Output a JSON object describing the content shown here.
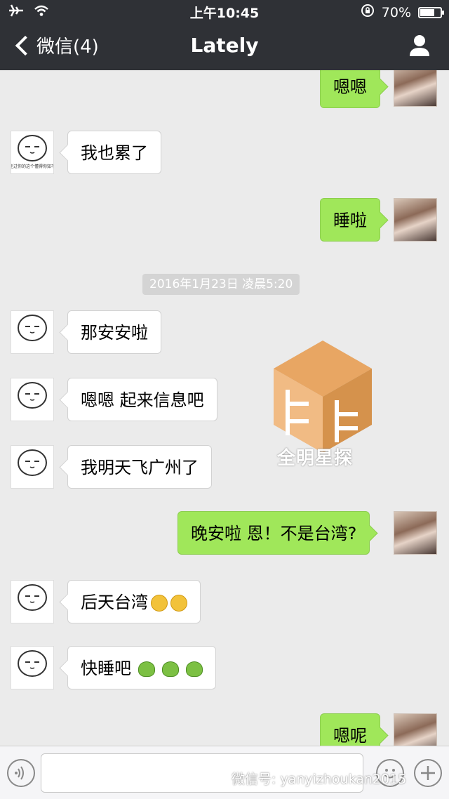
{
  "status_bar": {
    "time": "上午10:45",
    "battery": "70%",
    "battery_level": 0.7
  },
  "nav": {
    "back_label": "微信(4)",
    "title": "Lately"
  },
  "timestamp": "2016年1月23日 凌晨5:20",
  "messages": [
    {
      "side": "right",
      "text": "嗯嗯"
    },
    {
      "side": "left",
      "text": "我也累了"
    },
    {
      "side": "right",
      "text": "睡啦"
    },
    {
      "side": "left",
      "text": "那安安啦"
    },
    {
      "side": "left",
      "text": "嗯嗯 起来信息吧"
    },
    {
      "side": "left",
      "text": "我明天飞广州了"
    },
    {
      "side": "right",
      "text": "晚安啦 恩！不是台湾?"
    },
    {
      "side": "left",
      "text": "后天台湾"
    },
    {
      "side": "left",
      "text": "快睡吧"
    },
    {
      "side": "right",
      "text": "嗯呢"
    }
  ],
  "avatar_caption": "要走过你的这个懂得你知不知",
  "watermark": {
    "text": "全明星探"
  },
  "footer_watermark": "微信号: yanyizhoukan2015"
}
